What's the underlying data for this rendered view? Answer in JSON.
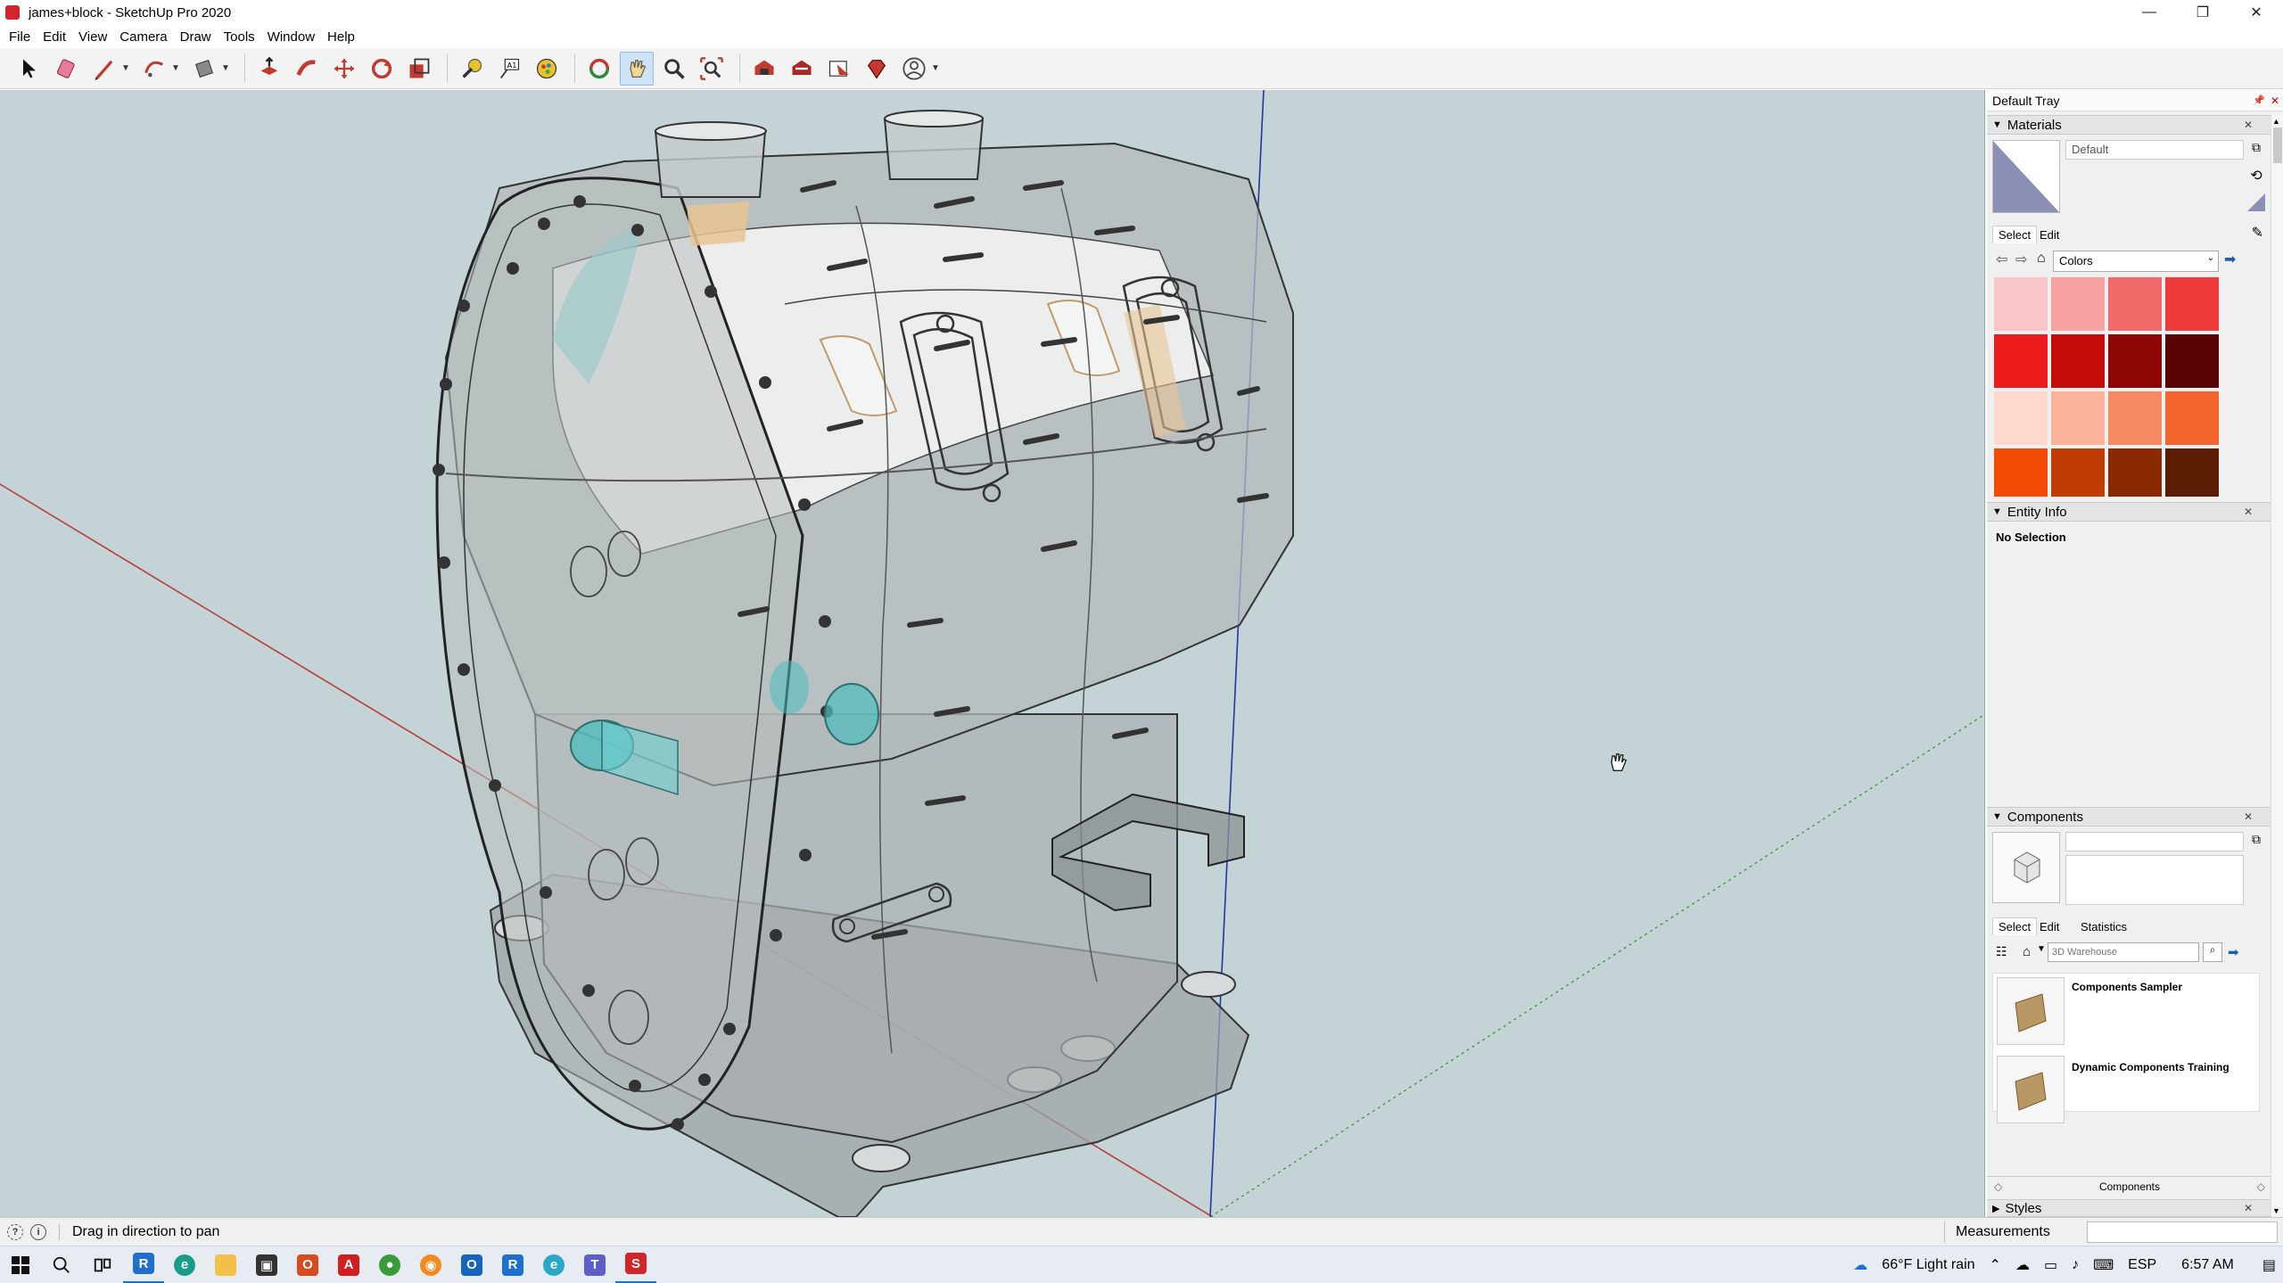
{
  "window": {
    "title": "james+block - SketchUp Pro 2020",
    "controls": {
      "minimize": "—",
      "restore": "❐",
      "close": "✕"
    }
  },
  "menu": [
    "File",
    "Edit",
    "View",
    "Camera",
    "Draw",
    "Tools",
    "Window",
    "Help"
  ],
  "toolbar": {
    "tools": [
      "select-icon",
      "eraser-icon",
      "pencil-line-icon",
      "arc-icon",
      "rectangle-icon",
      "push-pull-icon",
      "follow-me-icon",
      "move-icon",
      "rotate-icon",
      "scale-icon",
      "tape-measure-icon",
      "text-icon",
      "paint-bucket-icon",
      "orbit-icon",
      "pan-icon",
      "zoom-icon",
      "zoom-extents-icon",
      "warehouse-icon",
      "extension-warehouse-icon",
      "layout-icon",
      "ruby-icon",
      "account-icon"
    ],
    "active_tool": "pan-icon"
  },
  "tray": {
    "title": "Default Tray",
    "materials": {
      "header": "Materials",
      "name": "Default",
      "tabs": [
        "Select",
        "Edit"
      ],
      "library": "Colors",
      "swatches": [
        "#f9c7c9",
        "#f6a2a2",
        "#f26b6b",
        "#ee3b3b",
        "#ed1c1c",
        "#c60b0b",
        "#8e0707",
        "#5a0505",
        "#fdd9d0",
        "#fbb19a",
        "#f78a62",
        "#f4652f",
        "#f34a06",
        "#c13c05",
        "#8a2a04",
        "#5a1c03",
        "#fee3c6",
        "#fdc88e",
        "#fbad58",
        "#fa9a2c",
        "#e88a10",
        "#b86d0c",
        "#844f09",
        "#553306"
      ]
    },
    "entity_info": {
      "header": "Entity Info",
      "status": "No Selection"
    },
    "components": {
      "header": "Components",
      "tabs": [
        "Select",
        "Edit",
        "Statistics"
      ],
      "search_placeholder": "3D Warehouse",
      "items": [
        "Components Sampler",
        "Dynamic Components Training"
      ],
      "footer": "Components"
    },
    "styles": {
      "header": "Styles"
    }
  },
  "status": {
    "message": "Drag in direction to pan",
    "measurements_label": "Measurements"
  },
  "taskbar": {
    "weather": "66°F  Light rain",
    "language": "ESP",
    "time": "6:57 AM"
  }
}
